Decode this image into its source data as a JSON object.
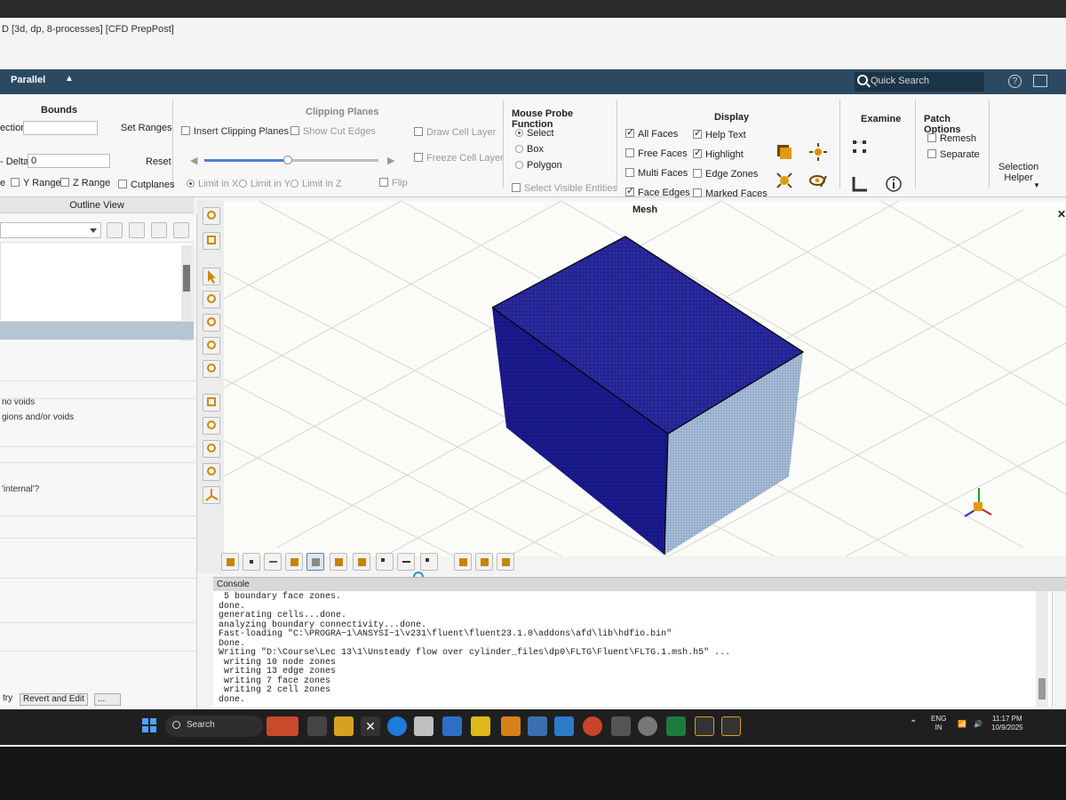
{
  "window": {
    "title": "D [3d, dp, 8-processes] [CFD PrepPost]"
  },
  "menubar": {
    "label": "Parallel",
    "quick_search": "Quick Search",
    "help": "?"
  },
  "ribbon": {
    "bounds": {
      "title": "Bounds",
      "selection_label": "ection",
      "set_ranges": "Set Ranges",
      "delta_label": "- Delta",
      "delta_value": "0",
      "reset": "Reset",
      "range_prefix": "e",
      "y_range": "Y Range",
      "z_range": "Z Range",
      "cutplanes": "Cutplanes"
    },
    "clipping": {
      "title": "Clipping Planes",
      "insert": "Insert Clipping Planes",
      "show_cut_edges": "Show Cut Edges",
      "draw_cell_layer": "Draw Cell Layer",
      "freeze_cell_layer": "Freeze Cell Layer",
      "limit_x": "Limit in X",
      "limit_y": "Limit in Y",
      "limit_z": "Limit in Z",
      "flip": "Flip",
      "slider_fraction": 0.48
    },
    "probe": {
      "title": "Mouse Probe Function",
      "select": "Select",
      "box": "Box",
      "polygon": "Polygon",
      "select_visible": "Select Visible Entities"
    },
    "display": {
      "title": "Display",
      "all_faces": "All Faces",
      "free_faces": "Free Faces",
      "multi_faces": "Multi Faces",
      "face_edges": "Face Edges",
      "help_text": "Help Text",
      "highlight": "Highlight",
      "edge_zones": "Edge Zones",
      "marked_faces": "Marked Faces"
    },
    "examine": {
      "title": "Examine"
    },
    "patch": {
      "title": "Patch Options",
      "remesh": "Remesh",
      "separate": "Separate"
    },
    "selection_helper": {
      "line1": "Selection",
      "line2": "Helper"
    }
  },
  "outline": {
    "header": "Outline View",
    "notes": [
      "no voids",
      "gions and/or voids",
      "'internal'?"
    ],
    "buttons": [
      "try",
      "Revert and Edit",
      "..."
    ]
  },
  "viewport": {
    "title": "Mesh"
  },
  "console": {
    "header": "Console",
    "lines": [
      " 5 boundary face zones.",
      "done.",
      "generating cells...done.",
      "analyzing boundary connectivity...done.",
      "Fast-loading \"C:\\PROGRA~1\\ANSYSI~1\\v231\\fluent\\fluent23.1.0\\addons\\afd\\lib\\hdfio.bin\"",
      "Done.",
      "Writing \"D:\\Course\\Lec 13\\1\\Unsteady flow over cylinder_files\\dp0\\FLTG\\Fluent\\FLTG.1.msh.h5\" ...",
      " writing 10 node zones",
      " writing 13 edge zones",
      " writing 7 face zones",
      " writing 2 cell zones",
      "done."
    ]
  },
  "taskbar": {
    "search": "Search",
    "lang_line1": "ENG",
    "lang_line2": "IN",
    "time": "11:17 PM",
    "date": "10/9/2025"
  },
  "colors": {
    "menubar": "#2b4a62",
    "mesh_top": "#2a2aa0",
    "mesh_side": "#1b1b8f",
    "mesh_face": "#8fa9c8"
  }
}
